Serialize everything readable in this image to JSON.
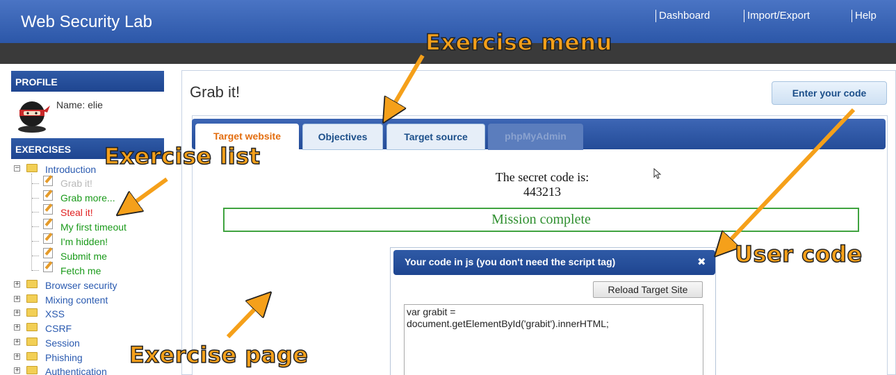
{
  "header": {
    "app_title": "Web Security Lab",
    "nav": [
      "Dashboard",
      "Import/Export",
      "Help"
    ]
  },
  "sidebar": {
    "profile_heading": "PROFILE",
    "profile_name": "Name: elie",
    "exercises_heading": "EXERCISES",
    "folders": [
      "Introduction",
      "Browser security",
      "Mixing content",
      "XSS",
      "CSRF",
      "Session",
      "Phishing",
      "Authentication"
    ],
    "intro_exercises": [
      {
        "label": "Grab it!",
        "state": "current"
      },
      {
        "label": "Grab more...",
        "state": "solved"
      },
      {
        "label": "Steal it!",
        "state": "unsolved"
      },
      {
        "label": "My first timeout",
        "state": "solved"
      },
      {
        "label": "I'm hidden!",
        "state": "solved"
      },
      {
        "label": "Submit me",
        "state": "solved"
      },
      {
        "label": "Fetch me",
        "state": "solved"
      }
    ]
  },
  "main": {
    "page_title": "Grab it!",
    "enter_code_label": "Enter your code",
    "tabs": [
      {
        "label": "Target website",
        "state": "active"
      },
      {
        "label": "Objectives",
        "state": "normal"
      },
      {
        "label": "Target source",
        "state": "normal"
      },
      {
        "label": "phpMyAdmin",
        "state": "disabled"
      }
    ],
    "secret_label": "The secret code is:",
    "secret_code": "443213",
    "mission_status": "Mission complete"
  },
  "dialog": {
    "title": "Your code in js (you don't need the script tag)",
    "close_glyph": "✖",
    "reload_label": "Reload Target Site",
    "code": "var grabit =\ndocument.getElementById('grabit').innerHTML;"
  },
  "annotations": {
    "exercise_menu": "Exercise menu",
    "exercise_list": "Exercise list",
    "user_code": "User code",
    "exercise_page": "Exercise page"
  },
  "colors": {
    "header_blue": "#2c57a8",
    "tab_active_text": "#e36d0e",
    "solved_green": "#1a9a1a",
    "unsolved_red": "#e02020",
    "annotation_orange": "#f5a01a"
  }
}
